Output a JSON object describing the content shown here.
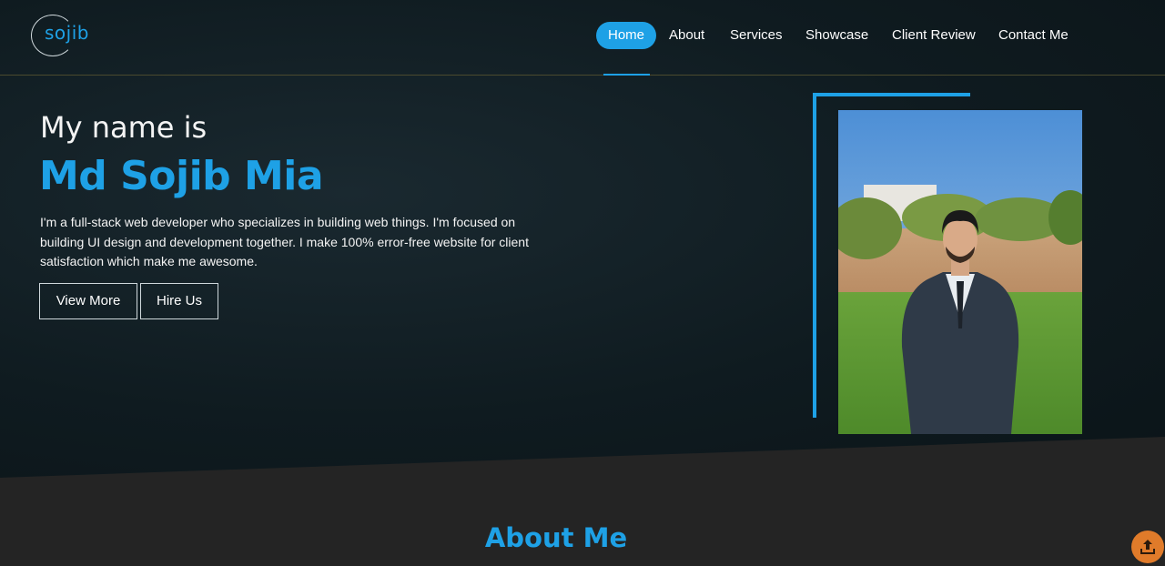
{
  "logo": {
    "text": "sojib"
  },
  "nav": {
    "items": [
      {
        "label": "Home",
        "active": true
      },
      {
        "label": "About"
      },
      {
        "label": "Services"
      },
      {
        "label": "Showcase"
      },
      {
        "label": "Client Review"
      },
      {
        "label": "Contact Me"
      }
    ]
  },
  "hero": {
    "intro": "My name is",
    "name": "Md Sojib Mia",
    "description": "I'm a full-stack web developer who specializes in building web things. I'm focused on building UI design and development together. I make 100% error-free website for client satisfaction which make me awesome.",
    "buttons": {
      "view_more": "View More",
      "hire_us": "Hire Us"
    }
  },
  "about": {
    "title": "About Me"
  },
  "colors": {
    "accent": "#1ea1e6",
    "scroll_button": "#e07b2a",
    "hero_bg": "#0f1b20",
    "section_bg": "#242424"
  },
  "icons": {
    "scroll_top": "arrow-up-tray-icon"
  }
}
